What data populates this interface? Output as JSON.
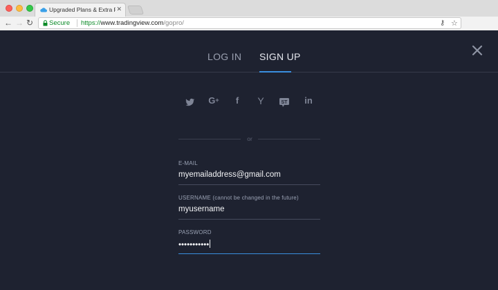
{
  "browser": {
    "tab_title": "Upgraded Plans & Extra Featu",
    "tab_close": "✕",
    "secure_label": "Secure",
    "url_scheme": "https://",
    "url_host": "www.tradingview.com",
    "url_path": "/gopro/",
    "icons": [
      "back-arrow-icon",
      "forward-arrow-icon",
      "reload-icon",
      "lock-icon",
      "key-icon",
      "star-icon"
    ]
  },
  "auth": {
    "tabs": [
      {
        "label": "LOG IN",
        "active": false
      },
      {
        "label": "SIGN UP",
        "active": true
      }
    ],
    "social": [
      {
        "name": "twitter",
        "glyph": "🐦"
      },
      {
        "name": "google-plus",
        "glyph": "G+"
      },
      {
        "name": "facebook",
        "glyph": "f"
      },
      {
        "name": "yahoo",
        "glyph": "Y"
      },
      {
        "name": "stocktwits",
        "glyph": "ST"
      },
      {
        "name": "linkedin",
        "glyph": "in"
      }
    ],
    "or_label": "or",
    "fields": {
      "email": {
        "label": "E-MAIL",
        "value": "myemailaddress@gmail.com"
      },
      "username": {
        "label": "USERNAME (cannot be changed in the future)",
        "value": "myusername"
      },
      "password": {
        "label": "PASSWORD",
        "value": "•••••••••••"
      }
    }
  },
  "colors": {
    "background": "#1e2230",
    "accent": "#3a8fe0",
    "secure_green": "#0a8a26"
  }
}
